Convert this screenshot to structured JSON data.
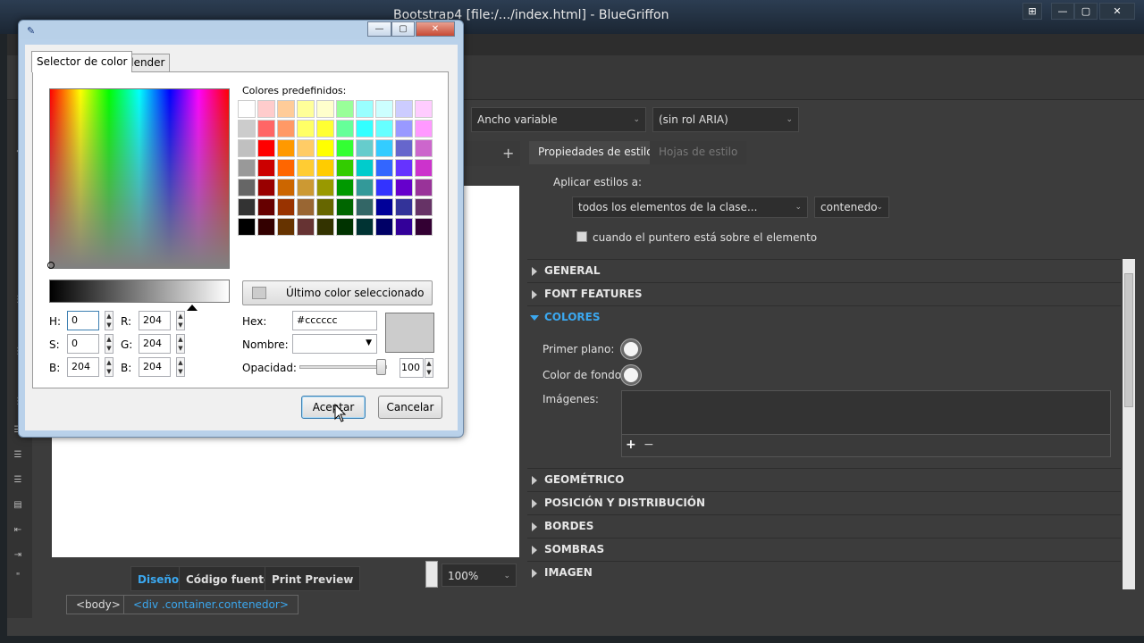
{
  "window": {
    "title": "BlueGriffon",
    "title_full": "Bootstrap4 [file:/.../index.html] - BlueGriffon",
    "controls": [
      "⊞",
      "—",
      "▢",
      "✕"
    ]
  },
  "toolbar": {
    "width_combo": "Ancho variable",
    "aria_combo": "(sin rol ARIA)"
  },
  "editor": {
    "mode_tabs": [
      "Diseño",
      "Código fuente",
      "Print Preview"
    ],
    "active_mode": "Diseño",
    "zoom": "100%",
    "breadcrumbs": [
      "<body>",
      "<div .container.contenedor>"
    ],
    "add_tab": "+"
  },
  "style_panel": {
    "tabs": [
      "Propiedades de estilo",
      "Hojas de estilo"
    ],
    "apply_label": "Aplicar estilos a:",
    "apply_target": "todos los elementos de la clase...",
    "class_name": "contenedo",
    "hover_label": "cuando el puntero está sobre el elemento",
    "sections": [
      "GENERAL",
      "FONT FEATURES",
      "COLORES",
      "GEOMÉTRICO",
      "POSICIÓN Y DISTRIBUCIÓN",
      "BORDES",
      "SOMBRAS",
      "IMAGEN"
    ],
    "open_section": "COLORES",
    "colors": {
      "foreground_label": "Primer plano:",
      "background_label": "Color de fondo:",
      "images_label": "Imágenes:",
      "add": "+",
      "remove": "−"
    }
  },
  "dialog": {
    "tabs": [
      "Selector de color",
      "Blender"
    ],
    "palette_label": "Colores predefinidos:",
    "last_color_label": "Último color seleccionado",
    "fields": {
      "H_label": "H:",
      "H": "0",
      "S_label": "S:",
      "S": "0",
      "B_label": "B:",
      "B": "204",
      "R_label": "R:",
      "R": "204",
      "G_label": "G:",
      "G": "204",
      "Bl_label": "B:",
      "Bl": "204"
    },
    "hex_label": "Hex:",
    "hex": "#cccccc",
    "name_label": "Nombre:",
    "opacity_label": "Opacidad:",
    "opacity": "100",
    "opacity_fraction": 1.0,
    "ok": "Aceptar",
    "cancel": "Cancelar",
    "current_color": "#cccccc",
    "palette": [
      [
        "#ffffff",
        "#ffcccc",
        "#ffcc99",
        "#ffff99",
        "#ffffcc",
        "#99ff99",
        "#99ffff",
        "#ccffff",
        "#ccccff",
        "#ffccff"
      ],
      [
        "#cccccc",
        "#ff6666",
        "#ff9966",
        "#ffff66",
        "#ffff33",
        "#66ff99",
        "#33ffff",
        "#66ffff",
        "#9999ff",
        "#ff99ff"
      ],
      [
        "#c0c0c0",
        "#ff0000",
        "#ff9900",
        "#ffcc66",
        "#ffff00",
        "#33ff33",
        "#66cccc",
        "#33ccff",
        "#6666cc",
        "#cc66cc"
      ],
      [
        "#999999",
        "#cc0000",
        "#ff6600",
        "#ffcc33",
        "#ffcc00",
        "#33cc00",
        "#00cccc",
        "#3366ff",
        "#6633ff",
        "#cc33cc"
      ],
      [
        "#666666",
        "#990000",
        "#cc6600",
        "#cc9933",
        "#999900",
        "#009900",
        "#339999",
        "#3333ff",
        "#6600cc",
        "#993399"
      ],
      [
        "#333333",
        "#660000",
        "#993300",
        "#996633",
        "#666600",
        "#006600",
        "#336666",
        "#000099",
        "#333399",
        "#663366"
      ],
      [
        "#000000",
        "#330000",
        "#663300",
        "#663333",
        "#333300",
        "#003300",
        "#003333",
        "#000066",
        "#330099",
        "#330033"
      ]
    ]
  }
}
